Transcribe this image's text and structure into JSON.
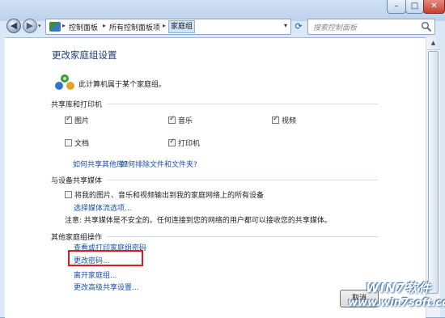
{
  "window": {
    "buttons": {
      "minimize": "–",
      "maximize": "□",
      "close": "✕"
    }
  },
  "navbar": {
    "back_glyph": "◀",
    "forward_glyph": "▶",
    "breadcrumbs": [
      "控制面板",
      "所有控制面板项",
      "家庭组"
    ],
    "search_placeholder": "搜索控制面板",
    "icons": [
      "back-icon",
      "forward-icon",
      "control-panel-icon",
      "chevron-right-icon",
      "refresh-icon",
      "search-icon"
    ]
  },
  "main": {
    "title": "更改家庭组设置",
    "status": "此计算机属于某个家庭组。",
    "share_section": {
      "heading": "共享库和打印机",
      "items": [
        {
          "label": "图片",
          "checked": true
        },
        {
          "label": "音乐",
          "checked": true
        },
        {
          "label": "视频",
          "checked": true
        },
        {
          "label": "文档",
          "checked": false
        },
        {
          "label": "打印机",
          "checked": true
        }
      ],
      "links": [
        "如何共享其他库?",
        "如何排除文件和文件夹?"
      ]
    },
    "media_section": {
      "heading": "与设备共享媒体",
      "checkbox_label": "将我的图片、音乐和视频输出到我的家庭网络上的所有设备",
      "checked": false,
      "link": "选择媒体流选项...",
      "note": "注意: 共享媒体是不安全的。任何连接到您的网络的用户都可以接收您的共享媒体。"
    },
    "other_section": {
      "heading": "其他家庭组操作",
      "links": [
        "查看或打印家庭组密码",
        "更改密码...",
        "离开家庭组...",
        "更改高级共享设置..."
      ]
    },
    "bottom_button": "取消"
  },
  "watermark": {
    "line1": "WIN7软件",
    "line2": "www.win7soft.com"
  },
  "colors": {
    "accent": "#1a4fa8",
    "highlight": "#e01a1a",
    "title": "#1e3e7a"
  }
}
